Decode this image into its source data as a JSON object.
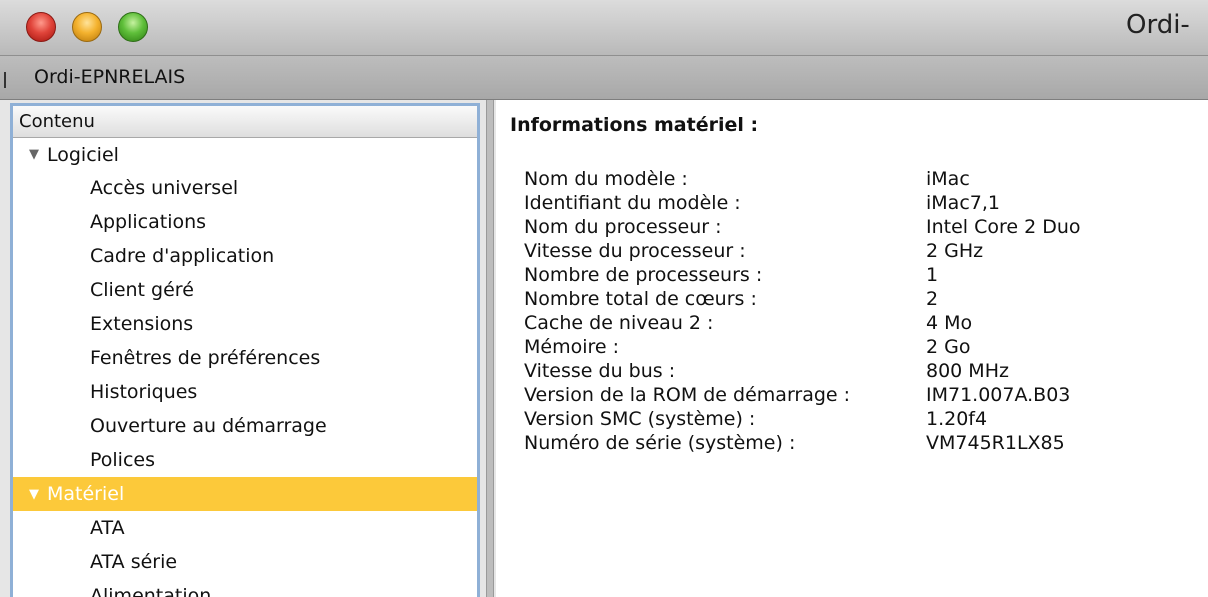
{
  "window": {
    "title": "Ordi-"
  },
  "toolbar": {
    "computer_name": "Ordi-EPNRELAIS"
  },
  "sidebar": {
    "header": "Contenu",
    "groups": [
      {
        "label": "Logiciel",
        "items": [
          "Accès universel",
          "Applications",
          "Cadre d'application",
          "Client géré",
          "Extensions",
          "Fenêtres de préférences",
          "Historiques",
          "Ouverture au démarrage",
          "Polices"
        ]
      },
      {
        "label": "Matériel",
        "selected": true,
        "items": [
          "ATA",
          "ATA série",
          "Alimentation"
        ]
      }
    ]
  },
  "main": {
    "heading": "Informations matériel :",
    "rows": [
      {
        "label": "Nom du modèle :",
        "value": "iMac"
      },
      {
        "label": "Identifiant du modèle :",
        "value": "iMac7,1"
      },
      {
        "label": "Nom du processeur :",
        "value": "Intel Core 2 Duo"
      },
      {
        "label": "Vitesse du processeur :",
        "value": "2 GHz"
      },
      {
        "label": "Nombre de processeurs :",
        "value": "1"
      },
      {
        "label": "Nombre total de cœurs :",
        "value": "2"
      },
      {
        "label": "Cache de niveau 2 :",
        "value": "4 Mo"
      },
      {
        "label": "Mémoire :",
        "value": "2 Go"
      },
      {
        "label": "Vitesse du bus :",
        "value": "800 MHz"
      },
      {
        "label": "Version de la ROM de démarrage :",
        "value": "IM71.007A.B03"
      },
      {
        "label": "Version SMC (système) :",
        "value": "1.20f4"
      },
      {
        "label": "Numéro de série (système) :",
        "value": "VM745R1LX85"
      }
    ]
  },
  "icons": {
    "disclosure": "disclosure-triangle-icon"
  },
  "colors": {
    "selection": "#fcc93a",
    "sidebar_border": "#8fb0d6"
  }
}
